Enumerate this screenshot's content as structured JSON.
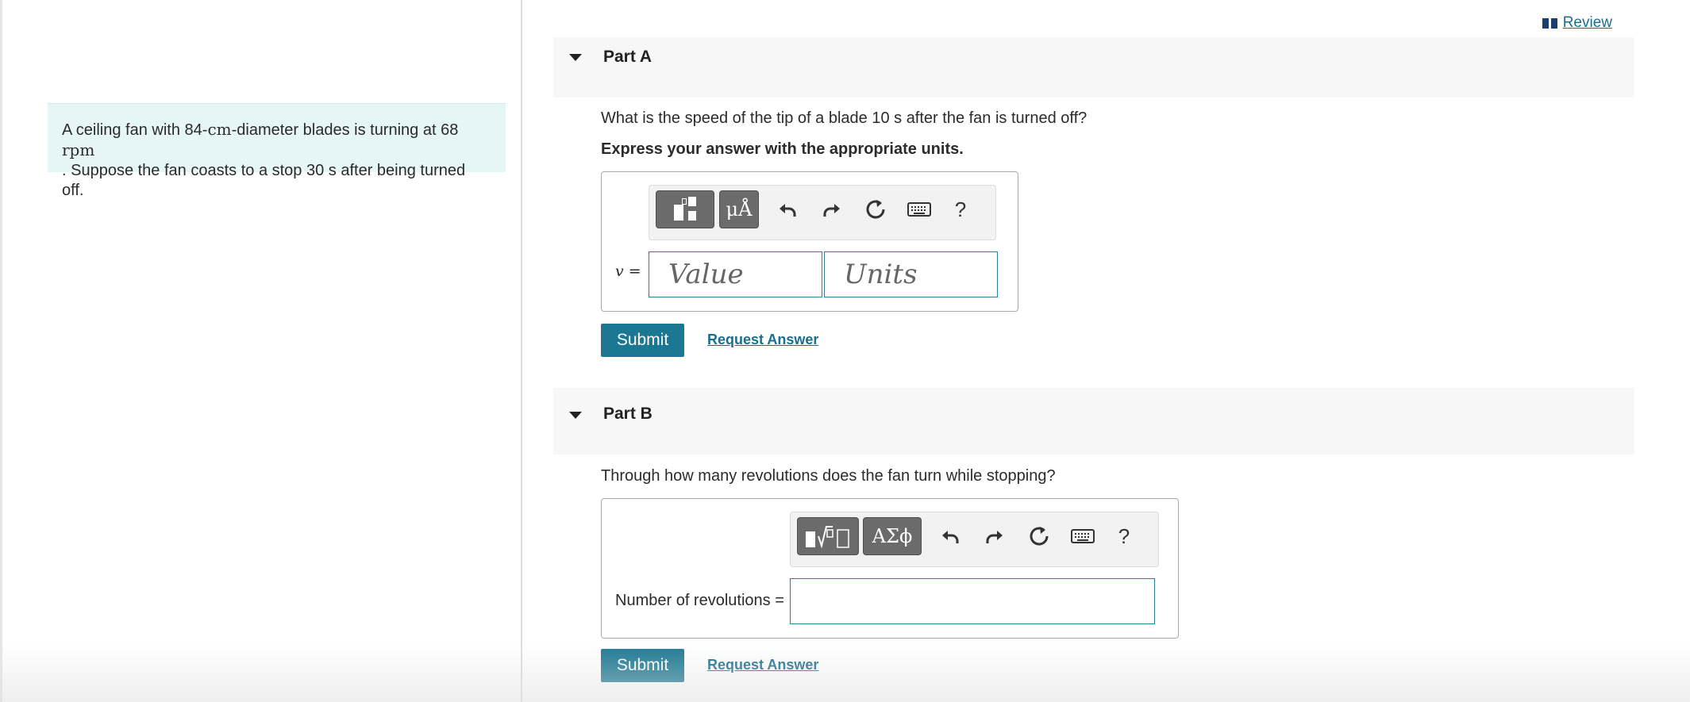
{
  "review": {
    "label": "Review",
    "icon": "book-icon"
  },
  "problem": {
    "text_1": "A ceiling fan with 84-",
    "unit_cm": "cm",
    "text_2": "-diameter blades is turning at 68 ",
    "unit_rpm": "rpm",
    "text_3": ". Suppose the fan coasts to a stop 30 s after being turned off."
  },
  "partA": {
    "title": "Part A",
    "question": "What is the speed of the tip of a blade 10 s after the fan is turned off?",
    "instruction": "Express your answer with the appropriate units.",
    "toolbar": {
      "units_button": "μÅ",
      "help": "?"
    },
    "variable_label": "v =",
    "value_placeholder": "Value",
    "units_placeholder": "Units",
    "submit_label": "Submit",
    "request_label": "Request Answer"
  },
  "partB": {
    "title": "Part B",
    "question": "Through how many revolutions does the fan turn while stopping?",
    "toolbar": {
      "symbols_button": "ΑΣϕ",
      "help": "?"
    },
    "answer_label": "Number of revolutions =",
    "answer_value": "",
    "submit_label": "Submit",
    "request_label": "Request Answer"
  },
  "colors": {
    "accent": "#1c7892",
    "link": "#1a6e8e",
    "problem_bg": "#e6f5f6",
    "header_bg": "#f7f7f7"
  }
}
